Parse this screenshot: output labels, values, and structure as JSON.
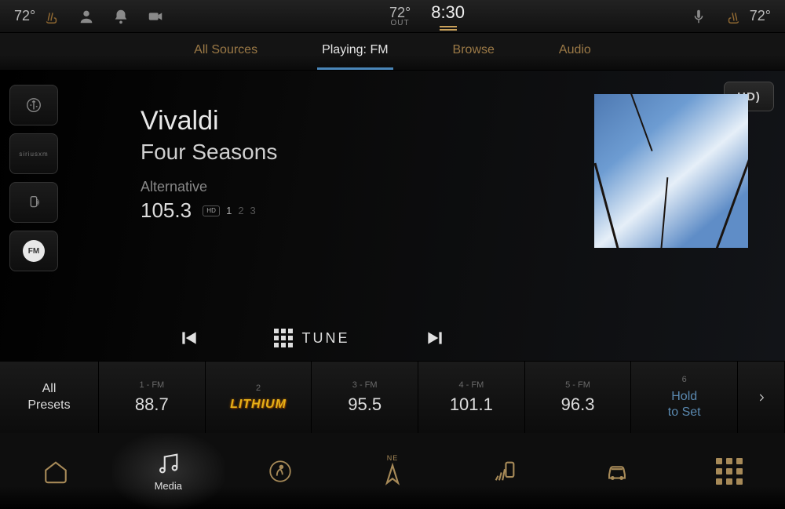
{
  "status": {
    "left_temp": "72°",
    "right_temp": "72°",
    "outside_temp": "72°",
    "outside_label": "OUT",
    "clock": "8:30"
  },
  "tabs": [
    {
      "label": "All Sources",
      "active": false
    },
    {
      "label": "Playing: FM",
      "active": true
    },
    {
      "label": "Browse",
      "active": false
    },
    {
      "label": "Audio",
      "active": false
    }
  ],
  "sources": [
    {
      "id": "usb",
      "label": ""
    },
    {
      "id": "siriusxm",
      "label": "siriusxm"
    },
    {
      "id": "bt-phone",
      "label": ""
    },
    {
      "id": "fm",
      "label": "FM",
      "active": true
    }
  ],
  "now_playing": {
    "title": "Vivaldi",
    "subtitle": "Four Seasons",
    "genre": "Alternative",
    "frequency": "105.3",
    "hd_channels": [
      "1",
      "2",
      "3"
    ],
    "hd_active": 0,
    "hd_button": "HD)"
  },
  "transport": {
    "tune_label": "TUNE"
  },
  "presets": {
    "all_label_1": "All",
    "all_label_2": "Presets",
    "items": [
      {
        "slot": "1 - FM",
        "value": "88.7"
      },
      {
        "slot": "2",
        "value": "LITHIUM",
        "logo": true
      },
      {
        "slot": "3 - FM",
        "value": "95.5"
      },
      {
        "slot": "4 - FM",
        "value": "101.1"
      },
      {
        "slot": "5 - FM",
        "value": "96.3"
      },
      {
        "slot": "6",
        "hold": true,
        "hold_l1": "Hold",
        "hold_l2": "to Set"
      }
    ]
  },
  "nav": [
    {
      "id": "home",
      "label": ""
    },
    {
      "id": "media",
      "label": "Media",
      "active": true
    },
    {
      "id": "comfort",
      "label": ""
    },
    {
      "id": "nav",
      "label": "",
      "heading": "NE"
    },
    {
      "id": "phone",
      "label": ""
    },
    {
      "id": "vehicle",
      "label": ""
    },
    {
      "id": "apps",
      "label": ""
    }
  ]
}
